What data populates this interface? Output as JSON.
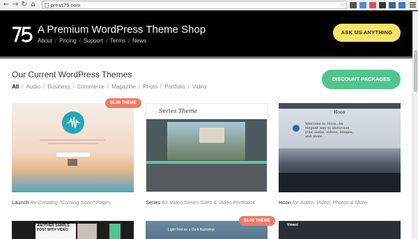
{
  "browser": {
    "url": "press75.com",
    "extension_colors": [
      "#555555",
      "#4a90d9",
      "#d9534f",
      "#333333",
      "#2f6aa0",
      "#3a7bd5"
    ]
  },
  "header": {
    "title": "A Premium WordPress Theme Shop",
    "nav": [
      "About",
      "Pricing",
      "Support",
      "Terms",
      "News"
    ],
    "cta_label": "ASK US ANYTHING"
  },
  "main": {
    "section_title": "Our Current WordPress Themes",
    "categories": [
      "All",
      "Audio",
      "Business",
      "Commerce",
      "Magazine",
      "Photo",
      "Portfolio",
      "Video"
    ],
    "active_category": "All",
    "discount_label": "DISCOUNT PACKAGES",
    "themes": [
      {
        "name": "Launch",
        "desc": "for Creating \"Coming Soon\" Pages",
        "price": "$5.00 THEME"
      },
      {
        "name": "Series",
        "desc": "for Video Series Sites & Video Portfolios",
        "preview_brand": "Series Theme"
      },
      {
        "name": "Hoon",
        "desc": "for Audio, Video, Photos & More",
        "preview_brand": "Hoon",
        "preview_text": "Welcome to Hoon. An elegant way to showcase your audio, videos, images, and more."
      }
    ],
    "row2": [
      {
        "preview_text": "ANOTHER SAMPLE POST WITH VIDEO"
      },
      {
        "price": "$5.00 THEME",
        "preview_text": "Light Text on a Dark Backdrop"
      },
      {
        "preview_text": "Viewst"
      }
    ]
  },
  "colors": {
    "header_bg": "#000000",
    "ask_button": "#f9e46b",
    "discount_button": "#52c48f",
    "price_badge": "#ee7b66"
  }
}
